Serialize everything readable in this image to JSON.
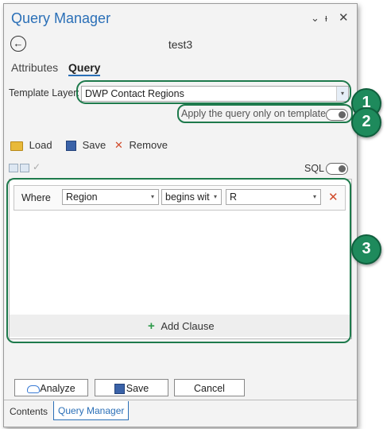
{
  "window": {
    "title": "Query Manager",
    "controls": {
      "dropdown": "⌄",
      "pin": "ᵻ",
      "close": "✕"
    }
  },
  "header": {
    "back_icon": "back-arrow-icon",
    "layer_name": "test3"
  },
  "tabs": [
    {
      "label": "Attributes"
    },
    {
      "label": "Query"
    }
  ],
  "template": {
    "label": "Template Layer:",
    "value": "DWP Contact Regions",
    "apply_label": "Apply the query only on template"
  },
  "toolbar": {
    "load": "Load",
    "save": "Save",
    "remove": "Remove"
  },
  "sql": {
    "label": "SQL"
  },
  "clause": {
    "where": "Where",
    "field": "Region",
    "operator": "begins wit",
    "value": "R"
  },
  "add_clause": "Add Clause",
  "actions": {
    "analyze": "Analyze",
    "save": "Save",
    "cancel": "Cancel"
  },
  "bottom_tabs": [
    {
      "label": "Contents"
    },
    {
      "label": "Query Manager"
    }
  ],
  "badges": [
    "1",
    "2",
    "3"
  ],
  "colors": {
    "title": "#2a6fb7",
    "badge": "#1e8a5c",
    "highlight": "#1e7a4c",
    "remove": "#d04a2a",
    "add": "#2d9a4a"
  }
}
